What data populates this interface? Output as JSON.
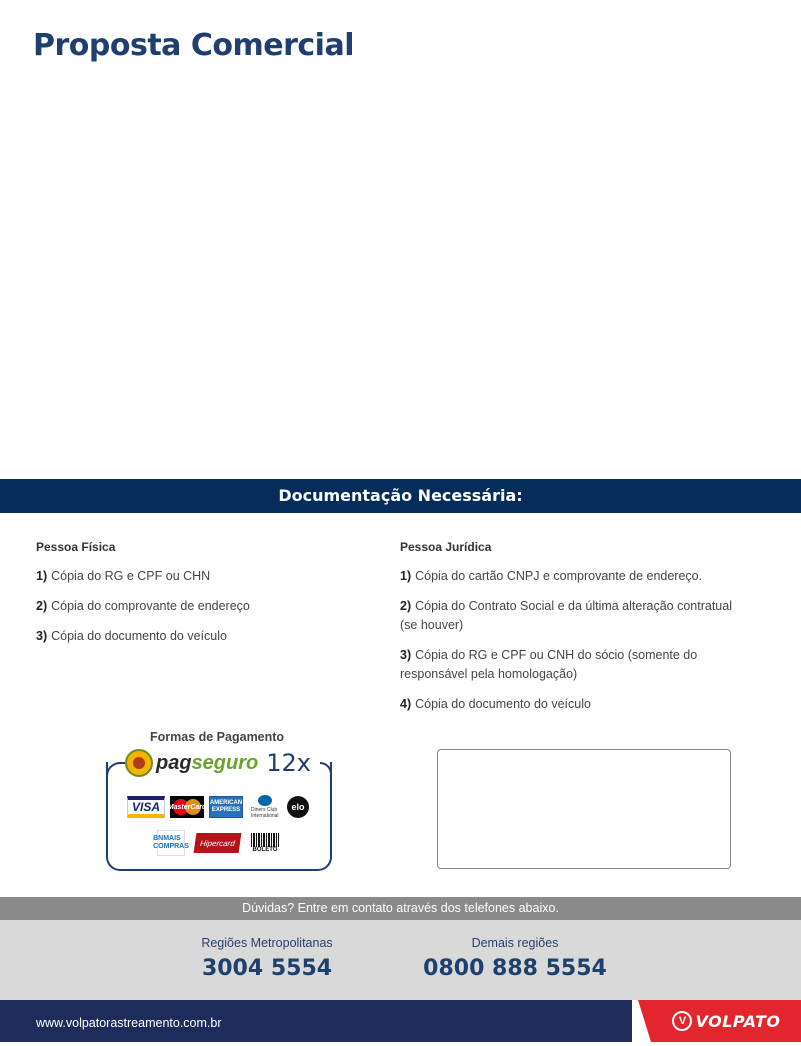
{
  "header": {
    "title": "Proposta Comercial"
  },
  "documentation": {
    "title": "Documentação Necessária:",
    "pessoa_fisica": {
      "heading": "Pessoa Física",
      "items": [
        {
          "num": "1)",
          "text": "Cópia do RG e CPF ou CHN"
        },
        {
          "num": "2)",
          "text": "Cópia do comprovante de endereço"
        },
        {
          "num": "3)",
          "text": "Cópia do documento do veículo"
        }
      ]
    },
    "pessoa_juridica": {
      "heading": "Pessoa Jurídica",
      "items": [
        {
          "num": "1)",
          "text": "Cópia do cartão CNPJ e comprovante de endereço."
        },
        {
          "num": "2)",
          "text": "Cópia do Contrato Social e da última alteração contratual (se houver)"
        },
        {
          "num": "3)",
          "text": "Cópia do RG e CPF ou CNH do sócio (somente do responsável pela homologação)"
        },
        {
          "num": "4)",
          "text": "Cópia do documento do veículo"
        }
      ]
    }
  },
  "payment": {
    "title": "Formas de Pagamento",
    "provider_pag": "pag",
    "provider_seguro": "seguro",
    "installments": "12x",
    "cards": {
      "visa": "VISA",
      "mastercard": "MasterCard",
      "amex": "AMERICAN EXPRESS",
      "diners": "Diners Club International",
      "elo": "elo",
      "bnmais": "BNMAIS COMPRAS",
      "hipercard": "Hipercard",
      "boleto": "BOLETO"
    }
  },
  "contact": {
    "prompt": "Dúvidas? Entre em contato através dos telefones abaixo.",
    "metro_label": "Regiões Metropolitanas",
    "metro_phone": "3004 5554",
    "other_label": "Demais regiões",
    "other_phone": "0800 888 5554"
  },
  "footer": {
    "url": "www.volpatorastreamento.com.br",
    "brand": "VOLPATO",
    "brand_mark": "V"
  },
  "colors": {
    "navy": "#042d5c",
    "title_blue": "#1f3f6e",
    "footer_navy": "#1e2c5c",
    "brand_red": "#e3262d",
    "gray_bar": "#8a8a8a",
    "contact_bg": "#d9d9d9"
  }
}
